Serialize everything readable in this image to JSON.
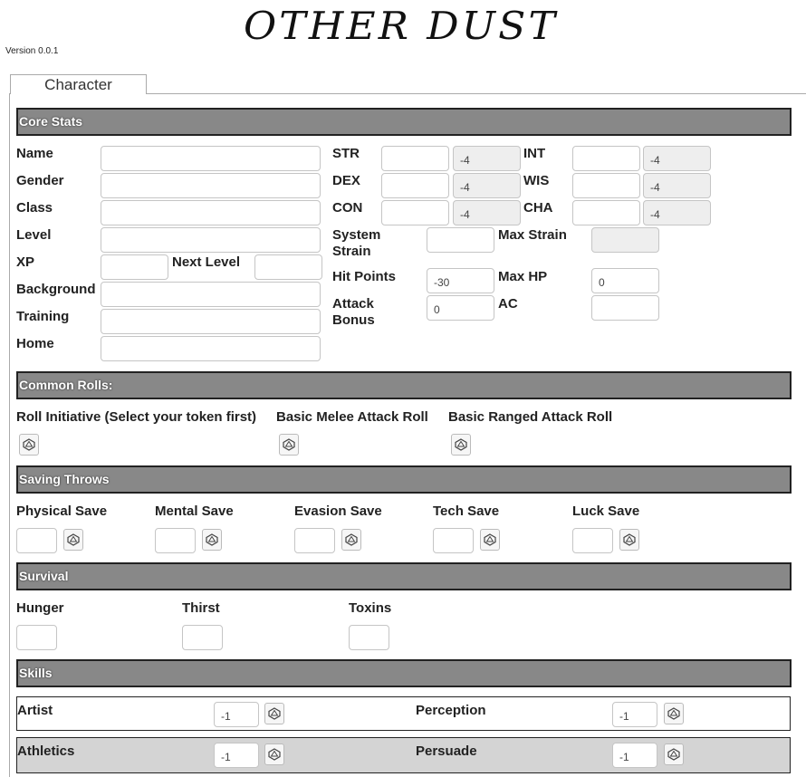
{
  "app": {
    "title": "OTHER DUST",
    "version": "Version 0.0.1"
  },
  "tabs": [
    {
      "label": "Character"
    }
  ],
  "sections": {
    "core_stats": "Core Stats",
    "common_rolls": "Common Rolls:",
    "saving_throws": "Saving Throws",
    "survival": "Survival",
    "skills": "Skills"
  },
  "core": {
    "name_label": "Name",
    "gender_label": "Gender",
    "class_label": "Class",
    "level_label": "Level",
    "xp_label": "XP",
    "next_level_label": "Next Level",
    "background_label": "Background",
    "training_label": "Training",
    "home_label": "Home"
  },
  "attributes": {
    "str": {
      "label": "STR",
      "mod": "-4"
    },
    "dex": {
      "label": "DEX",
      "mod": "-4"
    },
    "con": {
      "label": "CON",
      "mod": "-4"
    },
    "int": {
      "label": "INT",
      "mod": "-4"
    },
    "wis": {
      "label": "WIS",
      "mod": "-4"
    },
    "cha": {
      "label": "CHA",
      "mod": "-4"
    }
  },
  "derived": {
    "system_strain_label_1": "System",
    "system_strain_label_2": "Strain",
    "max_strain_label": "Max Strain",
    "hit_points_label": "Hit Points",
    "hit_points": "-30",
    "max_hp_label": "Max HP",
    "max_hp": "0",
    "attack_bonus_label_1": "Attack",
    "attack_bonus_label_2": "Bonus",
    "attack_bonus": "0",
    "ac_label": "AC"
  },
  "rolls": {
    "initiative": "Roll Initiative (Select your token first)",
    "melee": "Basic Melee Attack Roll",
    "ranged": "Basic Ranged Attack Roll"
  },
  "saves": {
    "physical": "Physical Save",
    "mental": "Mental Save",
    "evasion": "Evasion Save",
    "tech": "Tech Save",
    "luck": "Luck Save"
  },
  "survival": {
    "hunger": "Hunger",
    "thirst": "Thirst",
    "toxins": "Toxins"
  },
  "skills": [
    {
      "name": "Artist",
      "value": "-1"
    },
    {
      "name": "Perception",
      "value": "-1"
    },
    {
      "name": "Athletics",
      "value": "-1"
    },
    {
      "name": "Persuade",
      "value": "-1"
    }
  ],
  "icons": {
    "roll": "dice-icon"
  },
  "colors": {
    "section_bg": "#888888",
    "row_shade": "#d4d4d4",
    "readonly_bg": "#eeeeee"
  }
}
